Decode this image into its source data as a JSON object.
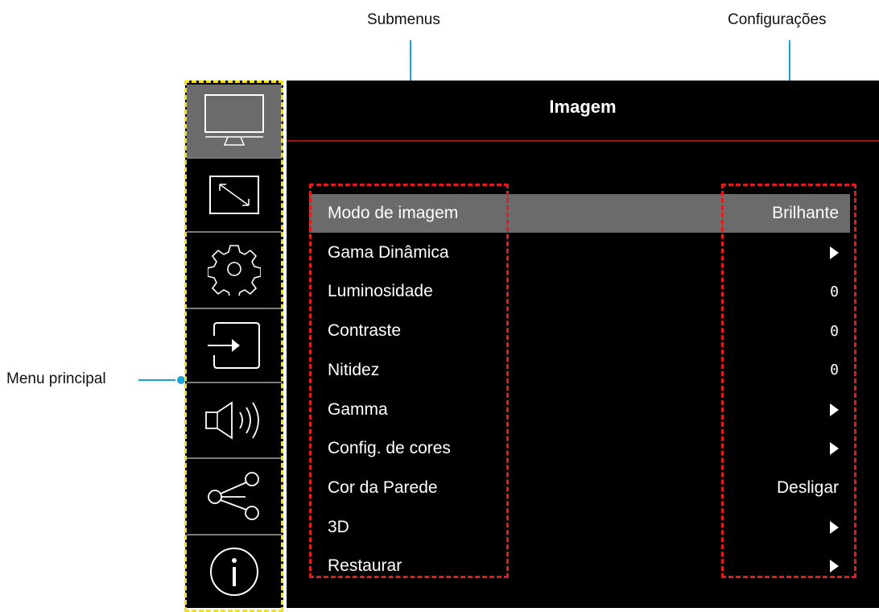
{
  "callouts": {
    "submenus": "Submenus",
    "settings": "Configurações",
    "main_menu": "Menu principal"
  },
  "panel": {
    "title": "Imagem"
  },
  "sidebar": {
    "items": [
      {
        "icon": "monitor-icon",
        "active": true
      },
      {
        "icon": "resize-icon"
      },
      {
        "icon": "gear-icon"
      },
      {
        "icon": "input-icon"
      },
      {
        "icon": "speaker-icon"
      },
      {
        "icon": "share-icon"
      },
      {
        "icon": "info-icon"
      }
    ]
  },
  "menu": {
    "rows": [
      {
        "label": "Modo de imagem",
        "value": "Brilhante",
        "type": "text"
      },
      {
        "label": "Gama Dinâmica",
        "value": "",
        "type": "arrow"
      },
      {
        "label": "Luminosidade",
        "value": "0",
        "type": "num"
      },
      {
        "label": "Contraste",
        "value": "0",
        "type": "num"
      },
      {
        "label": "Nitidez",
        "value": "0",
        "type": "num"
      },
      {
        "label": "Gamma",
        "value": "",
        "type": "arrow"
      },
      {
        "label": "Config. de cores",
        "value": "",
        "type": "arrow"
      },
      {
        "label": "Cor da Parede",
        "value": "Desligar",
        "type": "text"
      },
      {
        "label": "3D",
        "value": "",
        "type": "arrow"
      },
      {
        "label": "Restaurar",
        "value": "",
        "type": "arrow"
      }
    ]
  },
  "colors": {
    "highlight": "#6b6b6b",
    "callout": "#1aa3d9",
    "dash_red": "#e21c1c",
    "dash_yellow": "#f5e10b",
    "rule": "#a01010"
  }
}
